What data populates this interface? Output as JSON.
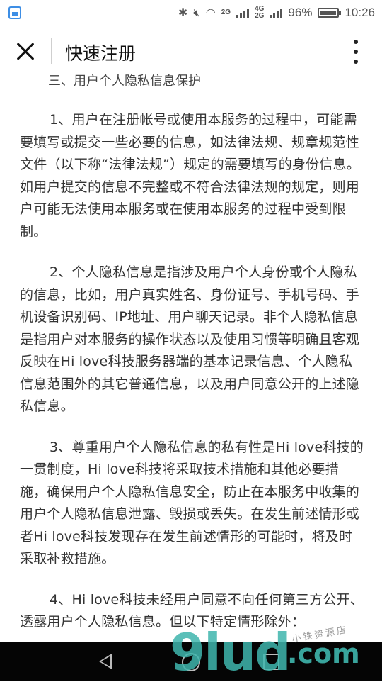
{
  "status_bar": {
    "network_small_top": "2G",
    "network_4g_top": "4G",
    "network_4g_bottom": "2G",
    "battery_percent": "96%",
    "time": "10:26"
  },
  "header": {
    "title": "快速注册"
  },
  "content": {
    "section_title": "三、用户个人隐私信息保护",
    "paragraphs": [
      "1、用户在注册帐号或使用本服务的过程中，可能需要填写或提交一些必要的信息，如法律法规、规章规范性文件（以下称“法律法规”）规定的需要填写的身份信息。如用户提交的信息不完整或不符合法律法规的规定，则用户可能无法使用本服务或在使用本服务的过程中受到限制。",
      "2、个人隐私信息是指涉及用户个人身份或个人隐私的信息，比如，用户真实姓名、身份证号、手机号码、手机设备识别码、IP地址、用户聊天记录。非个人隐私信息是指用户对本服务的操作状态以及使用习惯等明确且客观反映在Hi love科技服务器端的基本记录信息、个人隐私信息范围外的其它普通信息，以及用户同意公开的上述隐私信息。",
      "3、尊重用户个人隐私信息的私有性是Hi love科技的一贯制度，Hi love科技将采取技术措施和其他必要措施，确保用户个人隐私信息安全，防止在本服务中收集的用户个人隐私信息泄露、毁损或丢失。在发生前述情形或者Hi love科技发现存在发生前述情形的可能时，将及时采取补救措施。",
      "4、Hi love科技未经用户同意不向任何第三方公开、透露用户个人隐私信息。但以下特定情形除外："
    ]
  },
  "watermark": {
    "main": "9lud",
    "domain": ".com",
    "tagline": "小铁资源店"
  }
}
